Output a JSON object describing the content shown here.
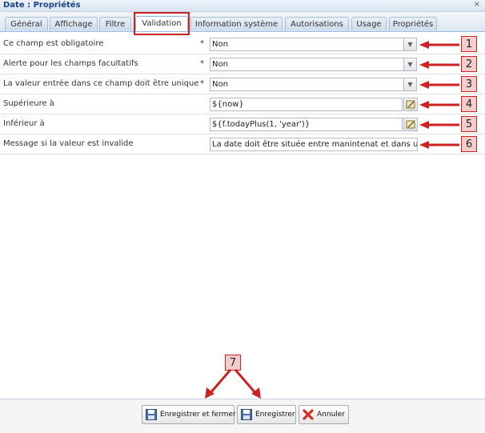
{
  "window": {
    "title": "Date : Propriétés",
    "close_glyph": "×"
  },
  "tabs": [
    {
      "label": "Général"
    },
    {
      "label": "Affichage"
    },
    {
      "label": "Filtre"
    },
    {
      "label": "Validation",
      "active": true
    },
    {
      "label": "Information système"
    },
    {
      "label": "Autorisations"
    },
    {
      "label": "Usage"
    },
    {
      "label": "Propriétés"
    }
  ],
  "fields": [
    {
      "label": "Ce champ est obligatoire",
      "required_mark": "*",
      "value": "Non",
      "type": "select",
      "callout": "1"
    },
    {
      "label": "Alerte pour les champs facultatifs",
      "required_mark": "*",
      "value": "Non",
      "type": "select",
      "callout": "2"
    },
    {
      "label": "La valeur entrée dans ce champ doit être unique",
      "required_mark": "*",
      "value": "Non",
      "type": "select",
      "callout": "3"
    },
    {
      "label": "Supérieure à",
      "value": "${now}",
      "type": "expression",
      "callout": "4"
    },
    {
      "label": "Inférieur à",
      "value": "${f.todayPlus(1, 'year')}",
      "type": "expression",
      "callout": "5"
    },
    {
      "label": "Message si la valeur est invalide",
      "value": "La date doit être située entre manintenat et dans un",
      "type": "text",
      "callout": "6"
    }
  ],
  "footer_callout": "7",
  "buttons": {
    "save_close": "Enregistrer et fermer",
    "save": "Enregistrer",
    "cancel": "Annuler"
  },
  "colors": {
    "annotation_red": "#cc2222",
    "badge_fill": "#f4cccc",
    "tab_border": "#99bbe8"
  },
  "icons": [
    "chevron-down-icon",
    "expression-editor-icon",
    "floppy-disk-icon",
    "close-x-icon"
  ]
}
